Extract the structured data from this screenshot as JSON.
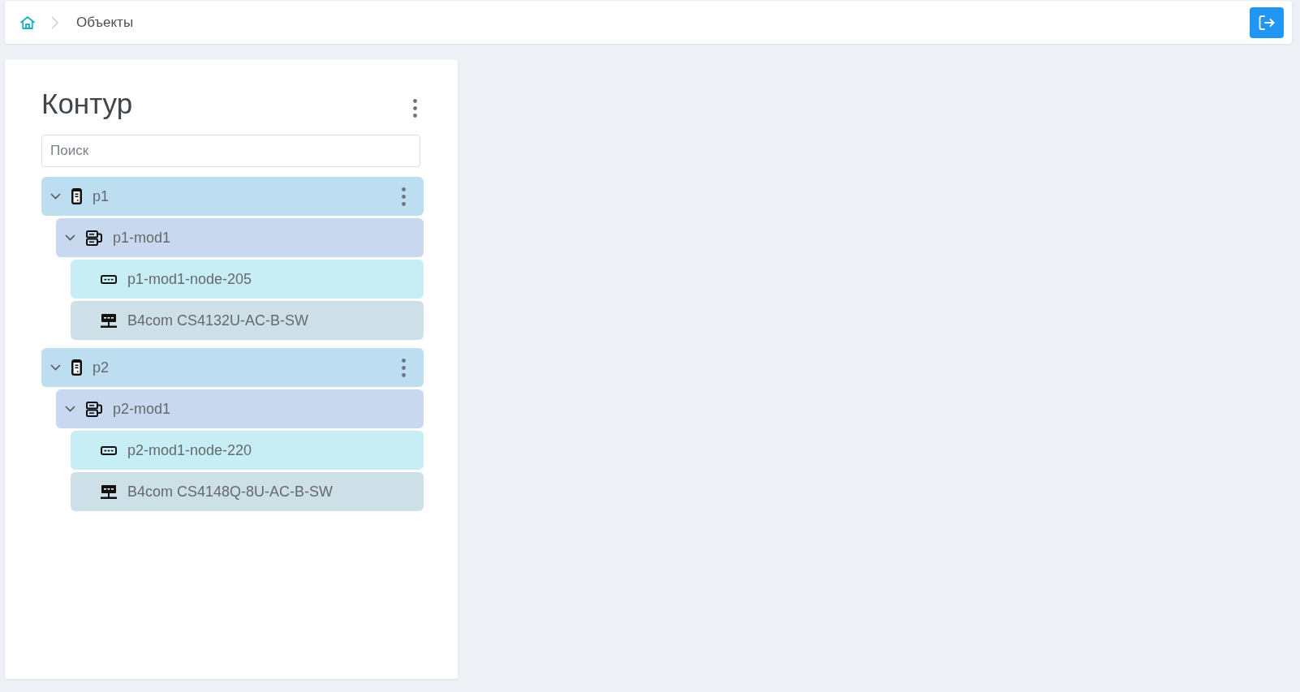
{
  "breadcrumb": [
    {
      "label": "Объекты"
    }
  ],
  "panel": {
    "title": "Контур",
    "search": {
      "placeholder": "Поиск"
    },
    "tree": [
      {
        "kind": "rack",
        "label": "p1",
        "expanded": true,
        "children": [
          {
            "kind": "module",
            "label": "p1-mod1",
            "expanded": true,
            "children": [
              {
                "kind": "node",
                "label": "p1-mod1-node-205"
              },
              {
                "kind": "switch",
                "label": "B4com CS4132U-AC-B-SW"
              }
            ]
          }
        ]
      },
      {
        "kind": "rack",
        "label": "p2",
        "expanded": true,
        "children": [
          {
            "kind": "module",
            "label": "p2-mod1",
            "expanded": true,
            "children": [
              {
                "kind": "node",
                "label": "p2-mod1-node-220"
              },
              {
                "kind": "switch",
                "label": "B4com CS4148Q-8U-AC-B-SW"
              }
            ]
          }
        ]
      }
    ]
  }
}
